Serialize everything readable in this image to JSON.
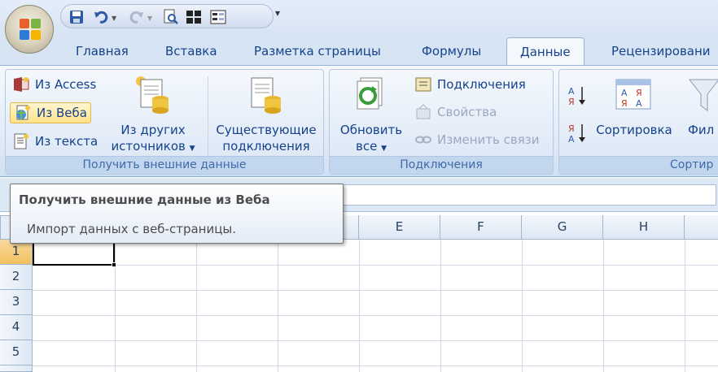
{
  "quick_access": {
    "items": [
      "save-icon",
      "undo-icon",
      "redo-icon",
      "print-preview-icon",
      "freeze-panes-icon",
      "form-icon"
    ],
    "customize_glyph": "▾"
  },
  "tabs": [
    {
      "label": "Главная",
      "active": false
    },
    {
      "label": "Вставка",
      "active": false
    },
    {
      "label": "Разметка страницы",
      "active": false
    },
    {
      "label": "Формулы",
      "active": false
    },
    {
      "label": "Данные",
      "active": true
    },
    {
      "label": "Рецензировани",
      "active": false
    }
  ],
  "ribbon": {
    "get_external": {
      "from_access": "Из Access",
      "from_web": "Из Веба",
      "from_text": "Из текста",
      "other_sources_line1": "Из других",
      "other_sources_line2": "источников",
      "existing_line1": "Существующие",
      "existing_line2": "подключения",
      "group_label": "Получить внешние данные"
    },
    "connections": {
      "refresh_line1": "Обновить",
      "refresh_line2": "все",
      "connections": "Подключения",
      "properties": "Свойства",
      "edit_links": "Изменить связи",
      "group_label": "Подключения"
    },
    "sort": {
      "sort": "Сортировка",
      "filter_partial": "Фил",
      "group_label": "Сортир"
    }
  },
  "tooltip": {
    "title": "Получить внешние данные из Веба",
    "body": "Импорт данных с веб-страницы."
  },
  "grid": {
    "columns": [
      "E",
      "F",
      "G",
      "H"
    ],
    "rows": [
      "1",
      "2",
      "3",
      "4",
      "5"
    ],
    "active_cell": "A1"
  },
  "colors": {
    "ribbon_text": "#15428b",
    "selection_header": "#f1c15f",
    "tab_bar": "#d7e4f4"
  }
}
